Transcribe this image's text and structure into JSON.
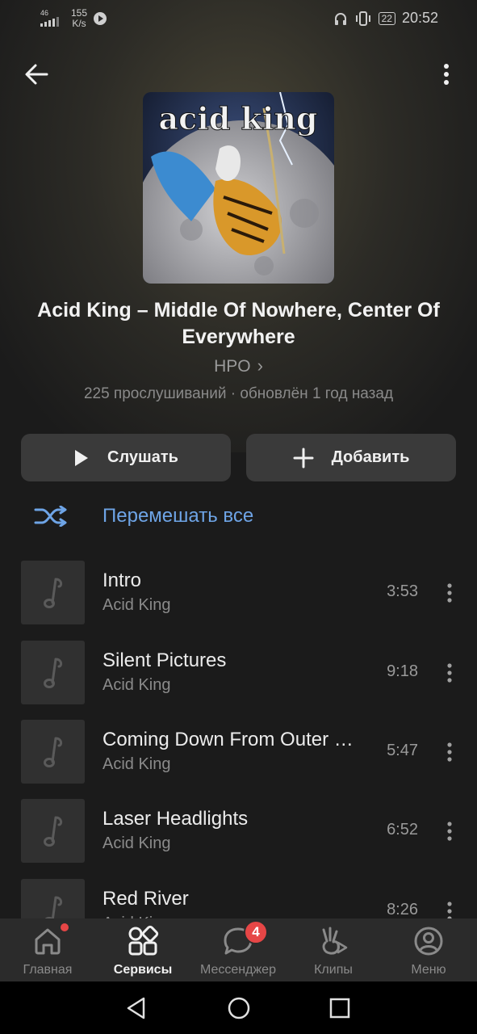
{
  "status_bar": {
    "network": "46",
    "speed_value": "155",
    "speed_unit": "K/s",
    "battery": "22",
    "time": "20:52"
  },
  "playlist": {
    "title": "Acid King – Middle Of Nowhere, Center Of Everywhere",
    "owner": "HPO",
    "meta": "225 прослушиваний · обновлён 1 год назад",
    "cover_text": "acid king"
  },
  "actions": {
    "listen_label": "Слушать",
    "add_label": "Добавить",
    "shuffle_label": "Перемешать все"
  },
  "tracks": [
    {
      "title": "Intro",
      "artist": "Acid King",
      "duration": "3:53"
    },
    {
      "title": "Silent Pictures",
      "artist": "Acid King",
      "duration": "9:18"
    },
    {
      "title": "Coming Down From Outer …",
      "artist": "Acid King",
      "duration": "5:47"
    },
    {
      "title": "Laser Headlights",
      "artist": "Acid King",
      "duration": "6:52"
    },
    {
      "title": "Red River",
      "artist": "Acid King",
      "duration": "8:26"
    }
  ],
  "bottom_nav": [
    {
      "label": "Главная",
      "icon": "home-icon"
    },
    {
      "label": "Сервисы",
      "icon": "services-icon"
    },
    {
      "label": "Мессенджер",
      "icon": "messenger-icon",
      "badge": "4"
    },
    {
      "label": "Клипы",
      "icon": "clips-icon"
    },
    {
      "label": "Меню",
      "icon": "profile-icon"
    }
  ],
  "colors": {
    "accent": "#6ea4e6",
    "badge": "#e64646",
    "background": "#1b1b1b"
  }
}
